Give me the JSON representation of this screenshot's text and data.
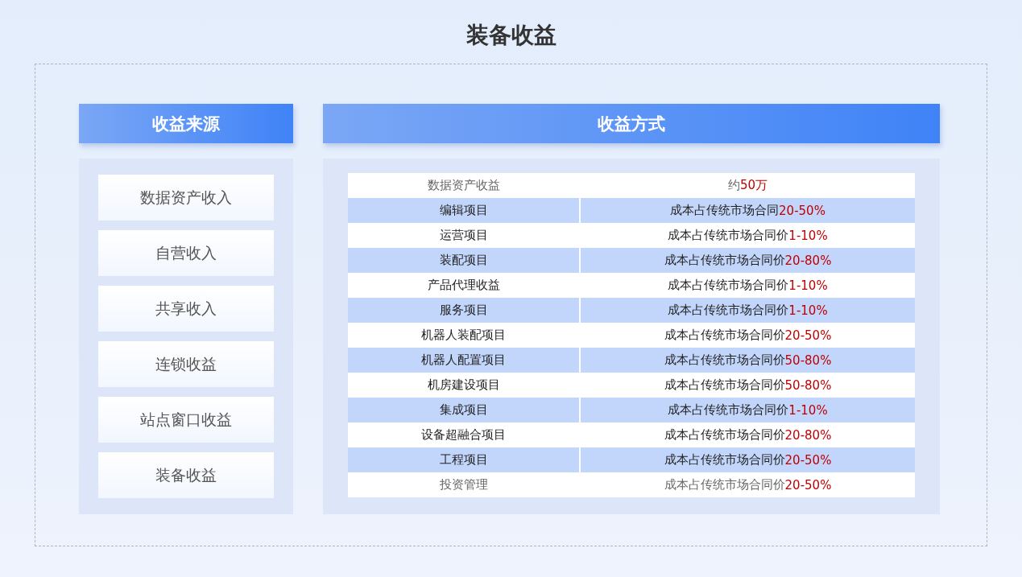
{
  "title": "装备收益",
  "sources": {
    "header": "收益来源",
    "items": [
      "数据资产收入",
      "自营收入",
      "共享收入",
      "连锁收益",
      "站点窗口收益",
      "装备收益"
    ]
  },
  "methods": {
    "header": "收益方式",
    "rows": [
      {
        "name": "数据资产收益",
        "text": "约",
        "figure": "50万",
        "dimmed": true
      },
      {
        "name": "编辑项目",
        "text": "成本占传统市场合同",
        "figure": "20-50%",
        "dimmed": false
      },
      {
        "name": "运营项目",
        "text": "成本占传统市场合同价",
        "figure": "1-10%",
        "dimmed": false
      },
      {
        "name": "装配项目",
        "text": "成本占传统市场合同价",
        "figure": "20-80%",
        "dimmed": false
      },
      {
        "name": "产品代理收益",
        "text": "成本占传统市场合同价",
        "figure": "1-10%",
        "dimmed": false
      },
      {
        "name": "服务项目",
        "text": "成本占传统市场合同价",
        "figure": "1-10%",
        "dimmed": false
      },
      {
        "name": "机器人装配项目",
        "text": "成本占传统市场合同价",
        "figure": "20-50%",
        "dimmed": false
      },
      {
        "name": "机器人配置项目",
        "text": "成本占传统市场合同价",
        "figure": "50-80%",
        "dimmed": false
      },
      {
        "name": "机房建设项目",
        "text": "成本占传统市场合同价",
        "figure": "50-80%",
        "dimmed": false
      },
      {
        "name": "集成项目",
        "text": "成本占传统市场合同价",
        "figure": "1-10%",
        "dimmed": false
      },
      {
        "name": "设备超融合项目",
        "text": "成本占传统市场合同价",
        "figure": "20-80%",
        "dimmed": false
      },
      {
        "name": "工程项目",
        "text": "成本占传统市场合同价",
        "figure": "20-50%",
        "dimmed": false
      },
      {
        "name": "投资管理",
        "text": "成本占传统市场合同价",
        "figure": "20-50%",
        "dimmed": true
      }
    ]
  }
}
